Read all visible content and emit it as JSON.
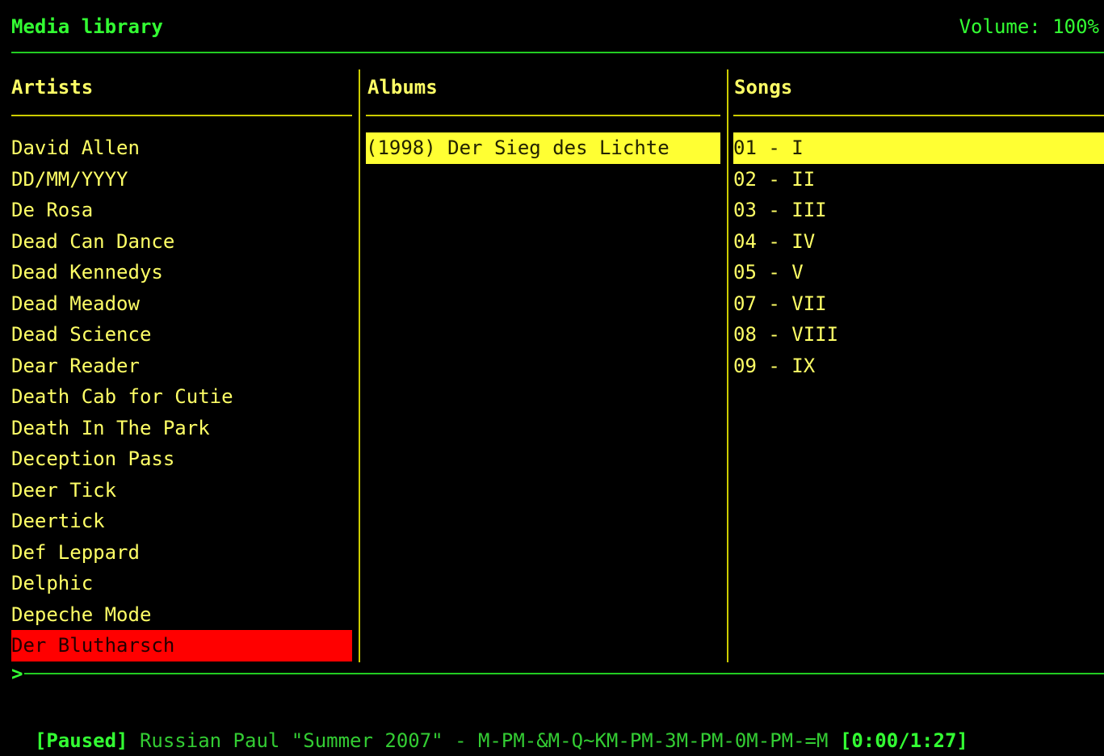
{
  "header": {
    "title": "Media library",
    "volume": "Volume: 100%"
  },
  "columns": {
    "artists_label": "Artists",
    "albums_label": "Albums",
    "songs_label": "Songs"
  },
  "artists": [
    "David Allen",
    "DD/MM/YYYY",
    "De Rosa",
    "Dead Can Dance",
    "Dead Kennedys",
    "Dead Meadow",
    "Dead Science",
    "Dear Reader",
    "Death Cab for Cutie",
    "Death In The Park",
    "Deception Pass",
    "Deer Tick",
    "Deertick",
    "Def Leppard",
    "Delphic",
    "Depeche Mode",
    "Der Blutharsch"
  ],
  "albums": [
    "(1998) Der Sieg des Lichte"
  ],
  "songs": [
    "01 - I",
    "02 - II",
    "03 - III",
    "04 - IV",
    "05 - V",
    "07 - VII",
    "08 - VIII",
    "09 - IX"
  ],
  "prompt": ">",
  "status": {
    "state": "[Paused]",
    "track": " Russian Paul \"Summer 2007\" - M-PM-&M-Q~KM-PM-3M-PM-0M-PM-=M ",
    "time": "[0:00/1:27]"
  },
  "colors": {
    "background": "#000000",
    "text": "#ffff66",
    "accent_green": "#33ff33",
    "artist_highlight": "#ff0000",
    "song_highlight": "#ffff33"
  }
}
